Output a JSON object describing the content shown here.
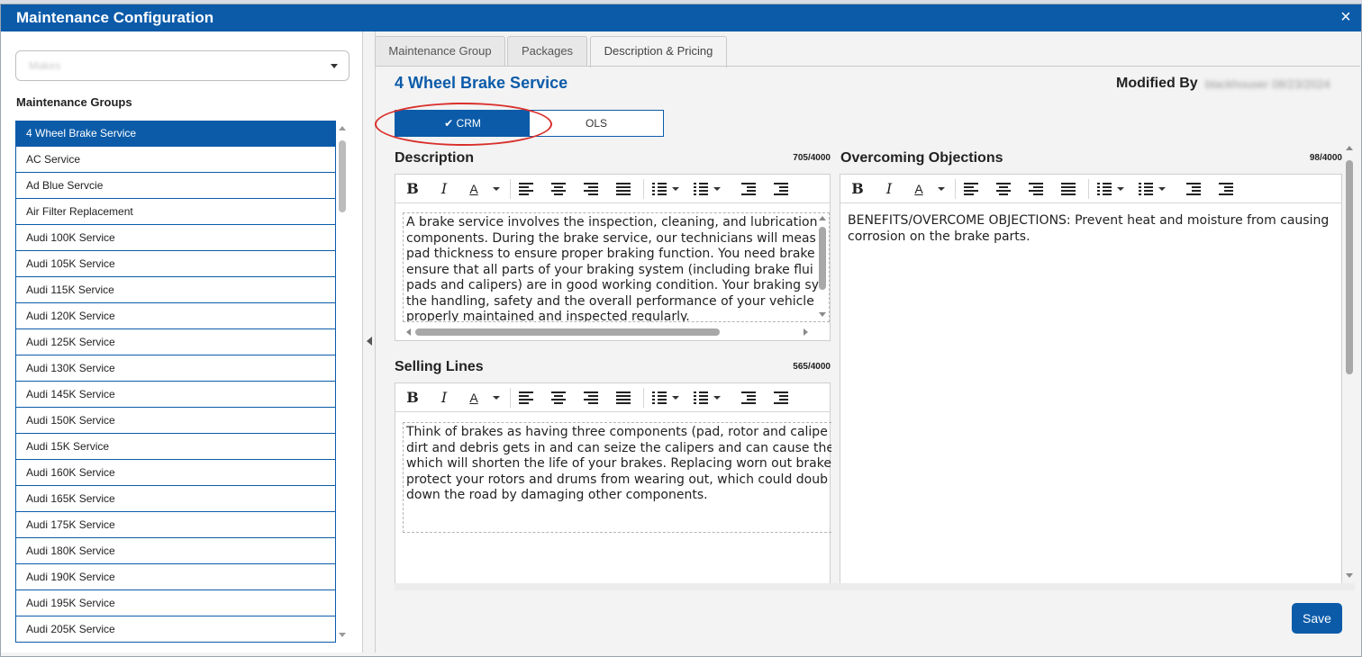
{
  "dialog": {
    "title": "Maintenance Configuration",
    "close_label": "×"
  },
  "left": {
    "dropdown_value": "Makes",
    "groups_label": "Maintenance Groups",
    "items": [
      "4 Wheel Brake Service",
      "AC Service",
      "Ad Blue Servcie",
      "Air Filter Replacement",
      "Audi 100K Service",
      "Audi 105K Service",
      "Audi 115K Service",
      "Audi 120K Service",
      "Audi 125K Service",
      "Audi 130K Service",
      "Audi 145K Service",
      "Audi 150K Service",
      "Audi 15K Service",
      "Audi 160K Service",
      "Audi 165K Service",
      "Audi 175K Service",
      "Audi 180K Service",
      "Audi 190K Service",
      "Audi 195K Service",
      "Audi 205K Service"
    ],
    "selected_index": 0
  },
  "tabs": [
    "Maintenance Group",
    "Packages",
    "Description & Pricing"
  ],
  "active_tab": "Description & Pricing",
  "service_title": "4 Wheel Brake Service",
  "modified_by_label": "Modified By",
  "modified_by_value": "blackhouser 08/23/2024",
  "toggle": {
    "crm_label": "CRM",
    "ols_label": "OLS",
    "selected": "CRM"
  },
  "annotation_color": "#d9302c",
  "accent_color": "#0b5ba9",
  "description": {
    "label": "Description",
    "counter": "705/4000",
    "lines": [
      "A brake service involves the inspection, cleaning, and lubrication",
      "components. During the brake service, our technicians will meas",
      "pad thickness to ensure proper braking function. You need brake",
      "ensure that all parts of your braking system (including brake flui",
      "pads and calipers) are in good working condition. Your braking sy",
      "the handling, safety and the overall performance of your vehicle",
      "properly maintained and inspected regularly."
    ]
  },
  "selling_lines": {
    "label": "Selling Lines",
    "counter": "565/4000",
    "lines": [
      "Think of brakes as having three components (pad, rotor and calipe",
      "dirt and debris gets in and can seize the calipers and can cause the",
      "which will shorten the life of your brakes. Replacing worn out brake",
      "protect your rotors and drums from wearing out, which could doub",
      "down the road by damaging other components."
    ]
  },
  "objections": {
    "label": "Overcoming Objections",
    "counter": "98/4000",
    "text": "BENEFITS/OVERCOME OBJECTIONS: Prevent heat and moisture from causing corrosion on the brake parts."
  },
  "toolbar_icons": [
    "bold-icon",
    "italic-icon",
    "font-color-icon",
    "align-left-icon",
    "align-center-icon",
    "align-right-icon",
    "justify-icon",
    "bullet-list-icon",
    "numbered-list-icon",
    "outdent-icon",
    "indent-icon"
  ],
  "toolbar_glyphs": {
    "bold": "B",
    "italic": "I",
    "font_color": "A"
  },
  "save_label": "Save"
}
